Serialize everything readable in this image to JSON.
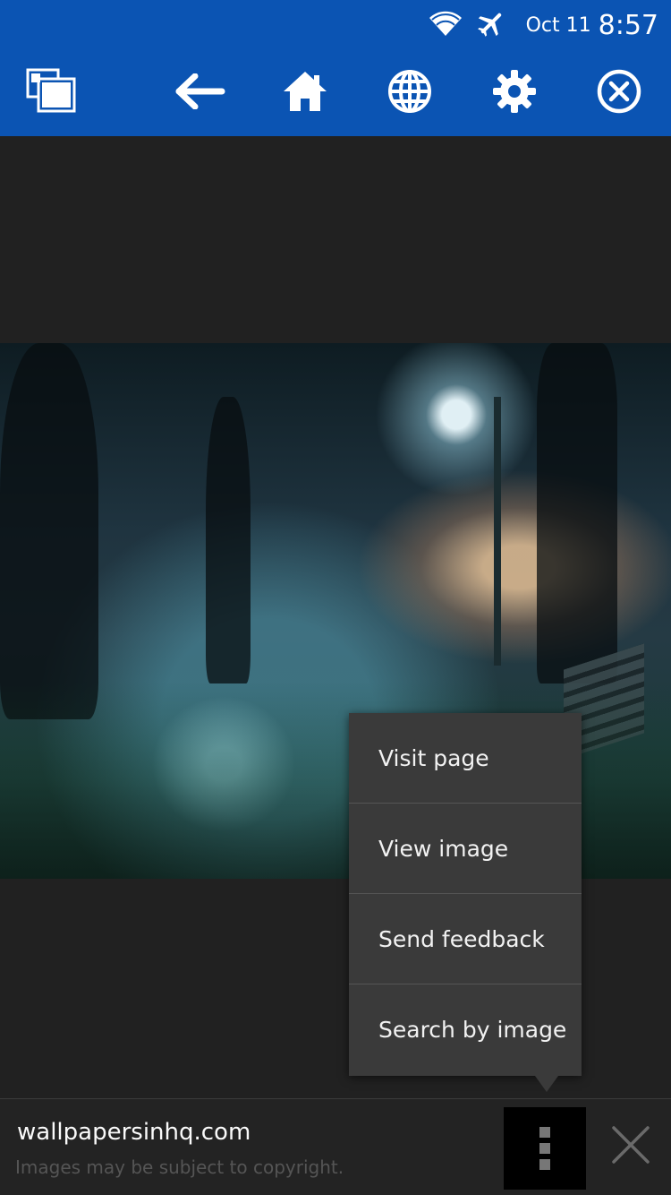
{
  "status_bar": {
    "date": "Oct 11",
    "time": "8:57",
    "icons": [
      "wifi-icon",
      "airplane-icon"
    ]
  },
  "toolbar": {
    "buttons": [
      "windows-icon",
      "back-arrow-icon",
      "home-icon",
      "globe-icon",
      "gear-icon",
      "close-circle-icon"
    ]
  },
  "context_menu": {
    "items": [
      {
        "label": "Visit page"
      },
      {
        "label": "View image"
      },
      {
        "label": "Send feedback"
      },
      {
        "label": "Search by image"
      }
    ]
  },
  "bottom_bar": {
    "site": "wallpapersinhq.com",
    "notice": "Images may be subject to copyright."
  },
  "colors": {
    "toolbar_bg": "#0b54b3",
    "background": "#212121",
    "menu_bg": "#3a3a3a"
  }
}
